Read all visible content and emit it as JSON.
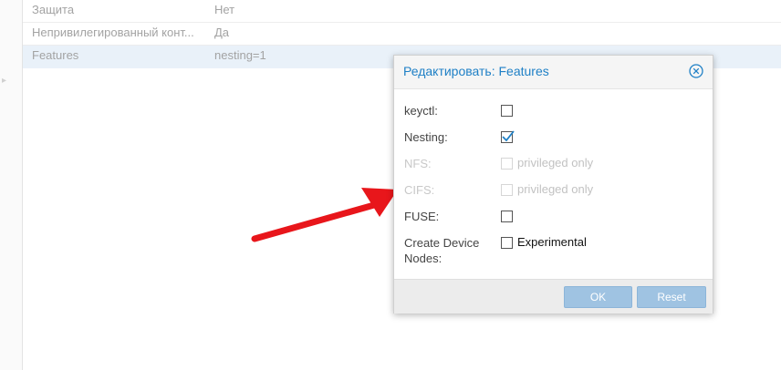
{
  "options_grid": {
    "rows": [
      {
        "key": "Защита",
        "value": "Нет",
        "selected": false
      },
      {
        "key": "Непривилегированный конт...",
        "value": "Да",
        "selected": false
      },
      {
        "key": "Features",
        "value": "nesting=1",
        "selected": true
      }
    ]
  },
  "dialog": {
    "title": "Редактировать: Features",
    "close_icon": "close-circle-icon",
    "fields": [
      {
        "label": "keyctl:",
        "checked": false,
        "disabled": false,
        "text": ""
      },
      {
        "label": "Nesting:",
        "checked": true,
        "disabled": false,
        "text": ""
      },
      {
        "label": "NFS:",
        "checked": false,
        "disabled": true,
        "text": "privileged only"
      },
      {
        "label": "CIFS:",
        "checked": false,
        "disabled": true,
        "text": "privileged only"
      },
      {
        "label": "FUSE:",
        "checked": false,
        "disabled": false,
        "text": ""
      },
      {
        "label": "Create Device Nodes:",
        "checked": false,
        "disabled": false,
        "text": "Experimental"
      }
    ],
    "buttons": {
      "ok_label": "OK",
      "reset_label": "Reset"
    }
  },
  "colors": {
    "accent": "#1f80c6",
    "selected_row": "#e9f1f9",
    "button_disabled": "#9fc3e2",
    "annotation_arrow": "#e8161b"
  },
  "icons": {
    "checkmark": "checkmark-icon",
    "rail_arrow": "chevron-right-icon"
  }
}
